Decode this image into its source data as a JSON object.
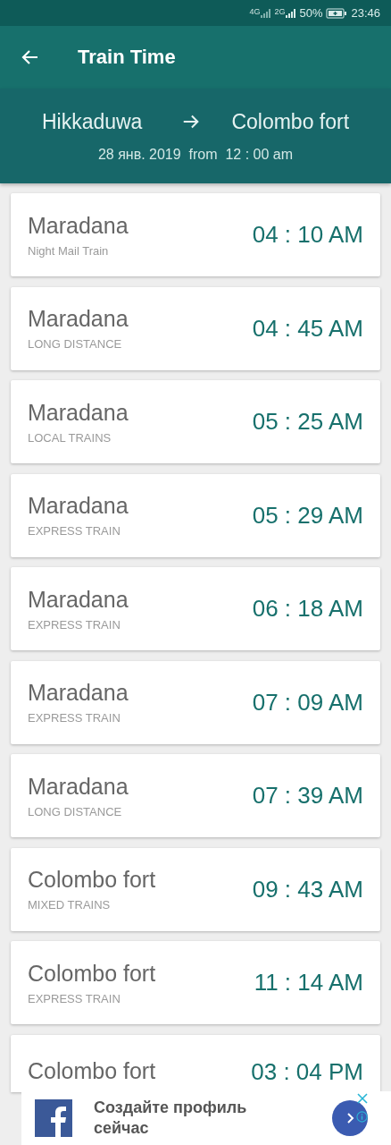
{
  "status_bar": {
    "network_1": "4G",
    "network_2": "2G",
    "battery": "50%",
    "time": "23:46"
  },
  "app_bar": {
    "title": "Train Time"
  },
  "route": {
    "from": "Hikkaduwa",
    "to": "Colombo fort",
    "date_line": "28 янв. 2019  from  12 : 00 am"
  },
  "trains": [
    {
      "destination": "Maradana",
      "type": "Night Mail Train",
      "time": "04 : 10 AM"
    },
    {
      "destination": "Maradana",
      "type": "LONG DISTANCE",
      "time": "04 : 45 AM"
    },
    {
      "destination": "Maradana",
      "type": "LOCAL TRAINS",
      "time": "05 : 25 AM"
    },
    {
      "destination": "Maradana",
      "type": "EXPRESS TRAIN",
      "time": "05 : 29 AM"
    },
    {
      "destination": "Maradana",
      "type": "EXPRESS TRAIN",
      "time": "06 : 18 AM"
    },
    {
      "destination": "Maradana",
      "type": "EXPRESS TRAIN",
      "time": "07 : 09 AM"
    },
    {
      "destination": "Maradana",
      "type": "LONG DISTANCE",
      "time": "07 : 39 AM"
    },
    {
      "destination": "Colombo fort",
      "type": "MIXED TRAINS",
      "time": "09 : 43 AM"
    },
    {
      "destination": "Colombo fort",
      "type": "EXPRESS TRAIN",
      "time": "11 : 14 AM"
    },
    {
      "destination": "Colombo fort",
      "time": "03 : 04 PM"
    }
  ],
  "ad": {
    "text": "Создайте профиль сейчас"
  }
}
